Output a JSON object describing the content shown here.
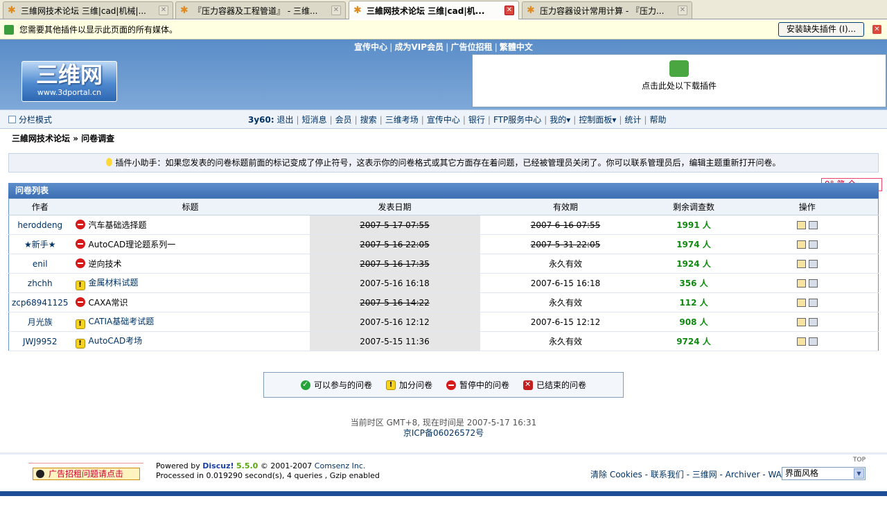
{
  "tabs": [
    {
      "title": "三維网技术论坛 三维|cad|机械|...",
      "active": false
    },
    {
      "title": "『压力容器及工程管道』 - 三维...",
      "active": false
    },
    {
      "title": "三維网技术论坛 三维|cad|机...",
      "active": true
    },
    {
      "title": "压力容器设计常用计算 - 『压力...",
      "active": false
    }
  ],
  "plugin_bar": {
    "message": "您需要其他插件以显示此页面的所有媒体。",
    "install_button": "安装缺失插件 (I)..."
  },
  "header": {
    "top_links": [
      "宣传中心",
      "成为VIP会员",
      "广告位招租",
      "繁體中文"
    ],
    "logo_text": "三维网",
    "logo_url": "www.3dportal.cn",
    "plugin_download": "点击此处以下载插件"
  },
  "menu": {
    "layout_mode": "分栏模式",
    "username": "3y60:",
    "links": [
      "退出",
      "短消息",
      "会员",
      "搜索",
      "三维考场",
      "宣传中心",
      "银行",
      "FTP服务中心",
      "我的▾",
      "控制面板▾",
      "统计",
      "帮助"
    ]
  },
  "breadcrumb": {
    "forum": "三維网技术论坛",
    "sep": "»",
    "current": "问卷调查"
  },
  "tip": "插件小助手：如果您发表的问卷标题前面的标记变成了停止符号，这表示你的问卷格式或其它方面存在着问题，已经被管理员关闭了。你可以联系管理员后，编辑主题重新打开问卷。",
  "lang_switch": "9° 简 全",
  "list": {
    "title": "问卷列表",
    "columns": [
      "作者",
      "标题",
      "发表日期",
      "有效期",
      "剩余调查数",
      "操作"
    ],
    "rows": [
      {
        "author": "heroddeng",
        "status": "stopped",
        "title": "汽车基础选择题",
        "date": "2007-5-17 07:55",
        "date_strike": true,
        "expiry": "2007-6-16 07:55",
        "expiry_strike": true,
        "remaining": "1991 人"
      },
      {
        "author": "★新手★",
        "status": "stopped",
        "title": "AutoCAD理论题系列一",
        "date": "2007-5-16 22:05",
        "date_strike": true,
        "expiry": "2007-5-31 22:05",
        "expiry_strike": true,
        "remaining": "1974 人"
      },
      {
        "author": "enil",
        "status": "stopped",
        "title": "逆向技术",
        "date": "2007-5-16 17:35",
        "date_strike": true,
        "expiry": "永久有效",
        "expiry_strike": false,
        "remaining": "1924 人"
      },
      {
        "author": "zhchh",
        "status": "bonus",
        "title": "金属材料试题",
        "date": "2007-5-16 16:18",
        "date_strike": false,
        "expiry": "2007-6-15 16:18",
        "expiry_strike": false,
        "remaining": "356 人"
      },
      {
        "author": "zcp68941125",
        "status": "stopped",
        "title": "CAXA常识",
        "date": "2007-5-16 14:22",
        "date_strike": true,
        "expiry": "永久有效",
        "expiry_strike": false,
        "remaining": "112 人"
      },
      {
        "author": "月光族",
        "status": "bonus",
        "title": "CATIA基础考试题",
        "date": "2007-5-16 12:12",
        "date_strike": false,
        "expiry": "2007-6-15 12:12",
        "expiry_strike": false,
        "remaining": "908 人"
      },
      {
        "author": "JWJ9952",
        "status": "bonus",
        "title": "AutoCAD考场",
        "date": "2007-5-15 11:36",
        "date_strike": false,
        "expiry": "永久有效",
        "expiry_strike": false,
        "remaining": "9724 人"
      }
    ]
  },
  "legend": {
    "available": "可以参与的问卷",
    "bonus": "加分问卷",
    "paused": "暂停中的问卷",
    "ended": "已结束的问卷"
  },
  "time_info": {
    "line": "当前时区 GMT+8, 现在时间是 2007-5-17 16:31",
    "icp": "京ICP备06026572号"
  },
  "footer": {
    "ad_button": "广告招租问题请点击",
    "powered_prefix": "Powered by ",
    "discuz": "Discuz!",
    "version": "5.5.0",
    "copyright": "© 2001-2007 ",
    "comsenz": "Comsenz Inc.",
    "processed": "Processed in 0.019290 second(s), 4 queries , Gzip enabled",
    "links": "清除 Cookies - 联系我们 - 三维网 - Archiver - WAP",
    "style_select": "界面风格",
    "top": "TOP"
  }
}
